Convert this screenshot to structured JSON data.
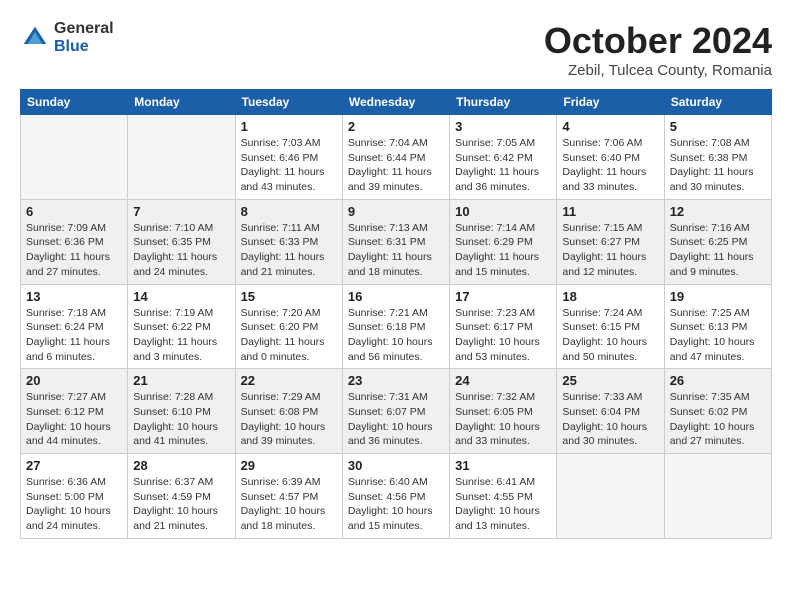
{
  "logo": {
    "general": "General",
    "blue": "Blue"
  },
  "title": "October 2024",
  "subtitle": "Zebil, Tulcea County, Romania",
  "days_of_week": [
    "Sunday",
    "Monday",
    "Tuesday",
    "Wednesday",
    "Thursday",
    "Friday",
    "Saturday"
  ],
  "weeks": [
    [
      {
        "day": "",
        "empty": true
      },
      {
        "day": "",
        "empty": true
      },
      {
        "day": "1",
        "sunrise": "Sunrise: 7:03 AM",
        "sunset": "Sunset: 6:46 PM",
        "daylight": "Daylight: 11 hours and 43 minutes."
      },
      {
        "day": "2",
        "sunrise": "Sunrise: 7:04 AM",
        "sunset": "Sunset: 6:44 PM",
        "daylight": "Daylight: 11 hours and 39 minutes."
      },
      {
        "day": "3",
        "sunrise": "Sunrise: 7:05 AM",
        "sunset": "Sunset: 6:42 PM",
        "daylight": "Daylight: 11 hours and 36 minutes."
      },
      {
        "day": "4",
        "sunrise": "Sunrise: 7:06 AM",
        "sunset": "Sunset: 6:40 PM",
        "daylight": "Daylight: 11 hours and 33 minutes."
      },
      {
        "day": "5",
        "sunrise": "Sunrise: 7:08 AM",
        "sunset": "Sunset: 6:38 PM",
        "daylight": "Daylight: 11 hours and 30 minutes."
      }
    ],
    [
      {
        "day": "6",
        "sunrise": "Sunrise: 7:09 AM",
        "sunset": "Sunset: 6:36 PM",
        "daylight": "Daylight: 11 hours and 27 minutes."
      },
      {
        "day": "7",
        "sunrise": "Sunrise: 7:10 AM",
        "sunset": "Sunset: 6:35 PM",
        "daylight": "Daylight: 11 hours and 24 minutes."
      },
      {
        "day": "8",
        "sunrise": "Sunrise: 7:11 AM",
        "sunset": "Sunset: 6:33 PM",
        "daylight": "Daylight: 11 hours and 21 minutes."
      },
      {
        "day": "9",
        "sunrise": "Sunrise: 7:13 AM",
        "sunset": "Sunset: 6:31 PM",
        "daylight": "Daylight: 11 hours and 18 minutes."
      },
      {
        "day": "10",
        "sunrise": "Sunrise: 7:14 AM",
        "sunset": "Sunset: 6:29 PM",
        "daylight": "Daylight: 11 hours and 15 minutes."
      },
      {
        "day": "11",
        "sunrise": "Sunrise: 7:15 AM",
        "sunset": "Sunset: 6:27 PM",
        "daylight": "Daylight: 11 hours and 12 minutes."
      },
      {
        "day": "12",
        "sunrise": "Sunrise: 7:16 AM",
        "sunset": "Sunset: 6:25 PM",
        "daylight": "Daylight: 11 hours and 9 minutes."
      }
    ],
    [
      {
        "day": "13",
        "sunrise": "Sunrise: 7:18 AM",
        "sunset": "Sunset: 6:24 PM",
        "daylight": "Daylight: 11 hours and 6 minutes."
      },
      {
        "day": "14",
        "sunrise": "Sunrise: 7:19 AM",
        "sunset": "Sunset: 6:22 PM",
        "daylight": "Daylight: 11 hours and 3 minutes."
      },
      {
        "day": "15",
        "sunrise": "Sunrise: 7:20 AM",
        "sunset": "Sunset: 6:20 PM",
        "daylight": "Daylight: 11 hours and 0 minutes."
      },
      {
        "day": "16",
        "sunrise": "Sunrise: 7:21 AM",
        "sunset": "Sunset: 6:18 PM",
        "daylight": "Daylight: 10 hours and 56 minutes."
      },
      {
        "day": "17",
        "sunrise": "Sunrise: 7:23 AM",
        "sunset": "Sunset: 6:17 PM",
        "daylight": "Daylight: 10 hours and 53 minutes."
      },
      {
        "day": "18",
        "sunrise": "Sunrise: 7:24 AM",
        "sunset": "Sunset: 6:15 PM",
        "daylight": "Daylight: 10 hours and 50 minutes."
      },
      {
        "day": "19",
        "sunrise": "Sunrise: 7:25 AM",
        "sunset": "Sunset: 6:13 PM",
        "daylight": "Daylight: 10 hours and 47 minutes."
      }
    ],
    [
      {
        "day": "20",
        "sunrise": "Sunrise: 7:27 AM",
        "sunset": "Sunset: 6:12 PM",
        "daylight": "Daylight: 10 hours and 44 minutes."
      },
      {
        "day": "21",
        "sunrise": "Sunrise: 7:28 AM",
        "sunset": "Sunset: 6:10 PM",
        "daylight": "Daylight: 10 hours and 41 minutes."
      },
      {
        "day": "22",
        "sunrise": "Sunrise: 7:29 AM",
        "sunset": "Sunset: 6:08 PM",
        "daylight": "Daylight: 10 hours and 39 minutes."
      },
      {
        "day": "23",
        "sunrise": "Sunrise: 7:31 AM",
        "sunset": "Sunset: 6:07 PM",
        "daylight": "Daylight: 10 hours and 36 minutes."
      },
      {
        "day": "24",
        "sunrise": "Sunrise: 7:32 AM",
        "sunset": "Sunset: 6:05 PM",
        "daylight": "Daylight: 10 hours and 33 minutes."
      },
      {
        "day": "25",
        "sunrise": "Sunrise: 7:33 AM",
        "sunset": "Sunset: 6:04 PM",
        "daylight": "Daylight: 10 hours and 30 minutes."
      },
      {
        "day": "26",
        "sunrise": "Sunrise: 7:35 AM",
        "sunset": "Sunset: 6:02 PM",
        "daylight": "Daylight: 10 hours and 27 minutes."
      }
    ],
    [
      {
        "day": "27",
        "sunrise": "Sunrise: 6:36 AM",
        "sunset": "Sunset: 5:00 PM",
        "daylight": "Daylight: 10 hours and 24 minutes."
      },
      {
        "day": "28",
        "sunrise": "Sunrise: 6:37 AM",
        "sunset": "Sunset: 4:59 PM",
        "daylight": "Daylight: 10 hours and 21 minutes."
      },
      {
        "day": "29",
        "sunrise": "Sunrise: 6:39 AM",
        "sunset": "Sunset: 4:57 PM",
        "daylight": "Daylight: 10 hours and 18 minutes."
      },
      {
        "day": "30",
        "sunrise": "Sunrise: 6:40 AM",
        "sunset": "Sunset: 4:56 PM",
        "daylight": "Daylight: 10 hours and 15 minutes."
      },
      {
        "day": "31",
        "sunrise": "Sunrise: 6:41 AM",
        "sunset": "Sunset: 4:55 PM",
        "daylight": "Daylight: 10 hours and 13 minutes."
      },
      {
        "day": "",
        "empty": true
      },
      {
        "day": "",
        "empty": true
      }
    ]
  ]
}
